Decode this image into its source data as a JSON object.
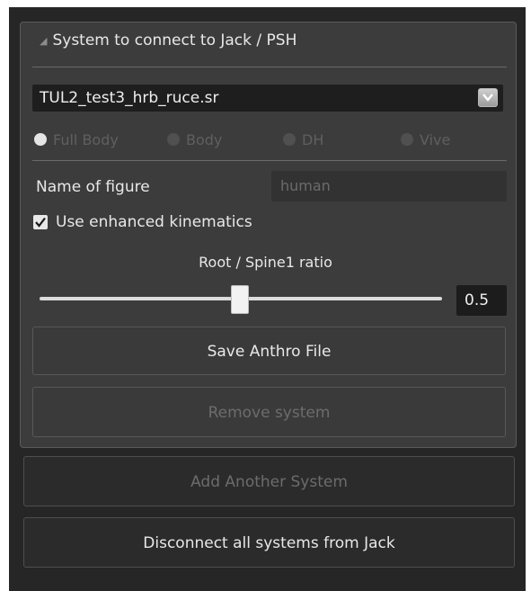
{
  "section": {
    "title": "System to connect to Jack / PSH"
  },
  "system_select": {
    "value": "TUL2_test3_hrb_ruce.sr"
  },
  "body_mode": {
    "options": [
      {
        "label": "Full Body",
        "selected": true
      },
      {
        "label": "Body",
        "selected": false
      },
      {
        "label": "DH",
        "selected": false
      },
      {
        "label": "Vive",
        "selected": false
      }
    ]
  },
  "figure": {
    "label": "Name of figure",
    "placeholder": "human"
  },
  "kinematics": {
    "label": "Use enhanced kinematics",
    "checked": true
  },
  "ratio": {
    "title": "Root / Spine1 ratio",
    "value": "0.5",
    "fraction": 0.5
  },
  "buttons": {
    "save_anthro": "Save Anthro File",
    "remove_system": "Remove system",
    "add_system": "Add Another System",
    "disconnect_all": "Disconnect all systems from Jack"
  },
  "colors": {
    "background": "#262626",
    "panel": "#3c3c3c",
    "text": "#e8e8e8",
    "disabled_text": "#6c6c6c"
  }
}
